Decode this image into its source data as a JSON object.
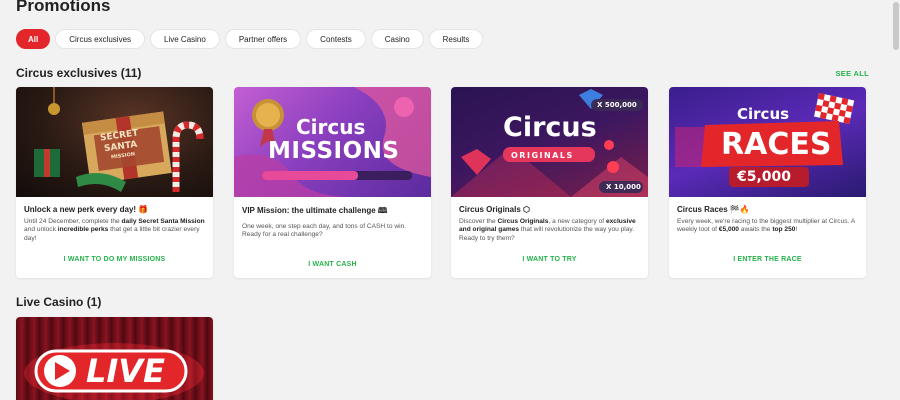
{
  "page": {
    "title": "Promotions"
  },
  "filters": [
    {
      "label": "All",
      "active": true
    },
    {
      "label": "Circus exclusives"
    },
    {
      "label": "Live Casino"
    },
    {
      "label": "Partner offers"
    },
    {
      "label": "Contests"
    },
    {
      "label": "Casino"
    },
    {
      "label": "Results"
    }
  ],
  "sections": {
    "exclusives": {
      "title": "Circus exclusives (11)",
      "see_all": "SEE ALL"
    },
    "live": {
      "title": "Live Casino (1)"
    }
  },
  "cards": [
    {
      "image": "santa-gift-image",
      "image_text": {
        "line1": "SECRET",
        "line2": "SANTA",
        "line3": "MISSION"
      },
      "title": "Unlock a new perk every day! 🎁",
      "desc_parts": [
        "Until 24 December, complete the ",
        "daily Secret Santa Mission",
        " and unlock ",
        "incredible perks",
        " that get a little bit crazier every day!"
      ],
      "cta": "I WANT TO DO MY MISSIONS"
    },
    {
      "image": "circus-missions-image",
      "image_text": {
        "line1": "Circus",
        "line2": "MISSIONS"
      },
      "title": "VIP Mission: the ultimate challenge 🕮",
      "desc_parts": [
        "One week, one step each day, and tons of CASH to win. Ready for a real challenge?"
      ],
      "cta": "I WANT CASH"
    },
    {
      "image": "circus-originals-image",
      "image_text": {
        "line1": "Circus",
        "line2": "ORIGINALS",
        "badge1": "X 500,000",
        "badge2": "X 10,000"
      },
      "title": "Circus Originals ⬡",
      "desc_parts": [
        "Discover the ",
        "Circus Originals",
        ", a new category of ",
        "exclusive and original games",
        " that will revolutionize the way you play. Ready to try them?"
      ],
      "cta": "I WANT TO TRY"
    },
    {
      "image": "circus-races-image",
      "image_text": {
        "line1": "Circus",
        "line2": "RACES",
        "line3": "€5,000"
      },
      "title": "Circus Races 🏁🔥",
      "desc_parts": [
        "Every week, we're racing to the biggest multiplier at Circus. A weekly loot of ",
        "€5,000",
        " awaits the ",
        "top 250",
        "!"
      ],
      "cta": "I ENTER THE RACE"
    }
  ],
  "live_card": {
    "image": "live-casino-image",
    "image_text": "LIVE"
  },
  "colors": {
    "accent": "#e3262a",
    "cta": "#25b34b",
    "background": "#f2f2f3"
  }
}
